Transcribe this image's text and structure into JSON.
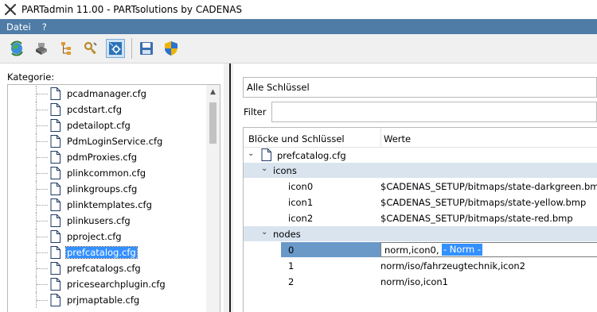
{
  "window": {
    "title": "PARTadmin 11.00 - PARTsolutions by CADENAS"
  },
  "menu": {
    "items": [
      "Datei",
      "?"
    ]
  },
  "toolbar": {
    "buttons": [
      {
        "name": "refresh-globe-icon",
        "color": "#2f7d32"
      },
      {
        "name": "server-icon",
        "color": "#555555"
      },
      {
        "name": "tree-structure-icon",
        "color": "#d98b1c"
      },
      {
        "name": "key-tools-icon",
        "color": "#b88a2a"
      },
      {
        "name": "settings-config-icon",
        "color": "#2a73b8"
      },
      {
        "name": "save-icon",
        "color": "#3a6fb0"
      },
      {
        "name": "shield-icon",
        "color": "#f0b400"
      }
    ]
  },
  "left": {
    "category_label": "Kategorie:",
    "files": [
      "pcadmanager.cfg",
      "pcdstart.cfg",
      "pdetailopt.cfg",
      "PdmLoginService.cfg",
      "pdmProxies.cfg",
      "plinkcommon.cfg",
      "plinkgroups.cfg",
      "plinktemplates.cfg",
      "plinkusers.cfg",
      "pproject.cfg",
      "prefcatalog.cfg",
      "prefcatalogs.cfg",
      "pricesearchplugin.cfg",
      "prjmaptable.cfg"
    ],
    "selected_file": "prefcatalog.cfg"
  },
  "right": {
    "scope_value": "Alle Schlüssel",
    "filter_label": "Filter",
    "filter_value": "",
    "columns": [
      "Blöcke und Schlüssel",
      "Werte"
    ],
    "tree": {
      "root": "prefcatalog.cfg",
      "blocks": [
        {
          "name": "icons",
          "keys": [
            {
              "key": "icon0",
              "value": "$CADENAS_SETUP/bitmaps/state-darkgreen.bmp"
            },
            {
              "key": "icon1",
              "value": "$CADENAS_SETUP/bitmaps/state-yellow.bmp"
            },
            {
              "key": "icon2",
              "value": "$CADENAS_SETUP/bitmaps/state-red.bmp"
            }
          ]
        },
        {
          "name": "nodes",
          "keys": [
            {
              "key": "0",
              "value": "norm,icon0,",
              "selected_fragment": "- Norm -"
            },
            {
              "key": "1",
              "value": "norm/iso/fahrzeugtechnik,icon2"
            },
            {
              "key": "2",
              "value": "norm/iso,icon1"
            }
          ]
        }
      ]
    }
  },
  "colors": {
    "menubar": "#4f7ca6",
    "selection": "#3390ff",
    "block_band": "#d9e4ef",
    "selected_key": "#6a99c8"
  }
}
